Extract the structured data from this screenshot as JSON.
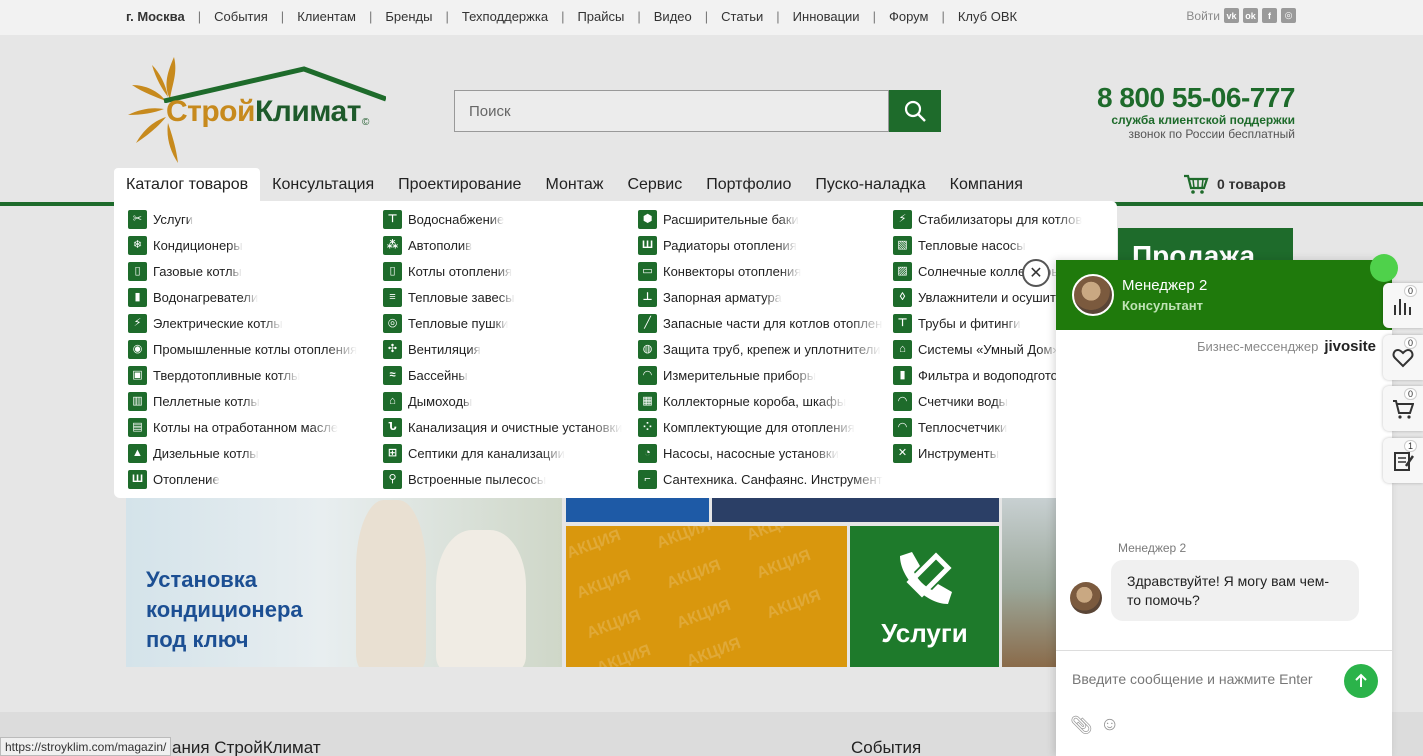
{
  "topbar": {
    "city": "г. Москва",
    "links": [
      "События",
      "Клиентам",
      "Бренды",
      "Техподдержка",
      "Прайсы",
      "Видео",
      "Статьи",
      "Инновации",
      "Форум",
      "Клуб ОВК"
    ],
    "login": "Войти",
    "social_icons": [
      "vk-icon",
      "odnoklassniki-icon",
      "facebook-icon",
      "instagram-icon"
    ]
  },
  "header": {
    "logo_part1": "Строй",
    "logo_part2": "Климат",
    "logo_mark": "©",
    "search_placeholder": "Поиск",
    "phone": "8 800 55-06-777",
    "phone_line1": "служба клиентской поддержки",
    "phone_line2": "звонок по России бесплатный"
  },
  "nav": {
    "items": [
      "Каталог товаров",
      "Консультация",
      "Проектирование",
      "Монтаж",
      "Сервис",
      "Портфолио",
      "Пуско-наладка",
      "Компания"
    ],
    "cart_label": "0 товаров"
  },
  "catalog": {
    "col1": [
      "Услуги",
      "Кондиционеры",
      "Газовые котлы",
      "Водонагреватели",
      "Электрические котлы",
      "Промышленные котлы отопления",
      "Твердотопливные котлы",
      "Пеллетные котлы",
      "Котлы на отработанном масле",
      "Дизельные котлы",
      "Отопление"
    ],
    "col2": [
      "Водоснабжение",
      "Автополив",
      "Котлы отопления",
      "Тепловые завесы",
      "Тепловые пушки",
      "Вентиляция",
      "Бассейны",
      "Дымоходы",
      "Канализация и очистные установки",
      "Септики для канализации",
      "Встроенные пылесосы"
    ],
    "col3": [
      "Расширительные баки",
      "Радиаторы отопления",
      "Конвекторы отопления",
      "Запорная арматура",
      "Запасные части для котлов отопления",
      "Защита труб, крепеж и уплотнители",
      "Измерительные приборы",
      "Коллекторные короба, шкафы",
      "Комплектующие для отопления",
      "Насосы, насосные установки",
      "Сантехника. Санфаянс. Инструменты"
    ],
    "col4": [
      "Стабилизаторы для котлов",
      "Тепловые насосы",
      "Солнечные коллекторы",
      "Увлажнители и осушители",
      "Трубы и фитинги",
      "Системы «Умный Дом»",
      "Фильтра и водоподготовка",
      "Счетчики воды",
      "Теплосчетчики",
      "Инструменты"
    ]
  },
  "banners": {
    "install_title": "Установка кондиционера под ключ",
    "akcia_word": "АКЦИЯ",
    "services_label": "Услуги",
    "sale_label": "Продажа"
  },
  "footer": {
    "left_heading": "ания СтройКлимат",
    "right_heading": "События",
    "status_url": "https://stroyklim.com/magazin/"
  },
  "chat": {
    "manager_name": "Менеджер 2",
    "manager_role": "Консультант",
    "business_messenger": "Бизнес-мессенджер",
    "brand": "jivosite",
    "sender": "Менеджер 2",
    "message": "Здравствуйте! Я могу вам чем-то помочь?",
    "input_placeholder": "Введите сообщение и нажмите Enter"
  },
  "side_tabs": [
    {
      "icon": "compare-icon",
      "count": "0"
    },
    {
      "icon": "heart-icon",
      "count": "0"
    },
    {
      "icon": "cart-icon",
      "count": "0"
    },
    {
      "icon": "notepad-icon",
      "count": "1"
    }
  ]
}
